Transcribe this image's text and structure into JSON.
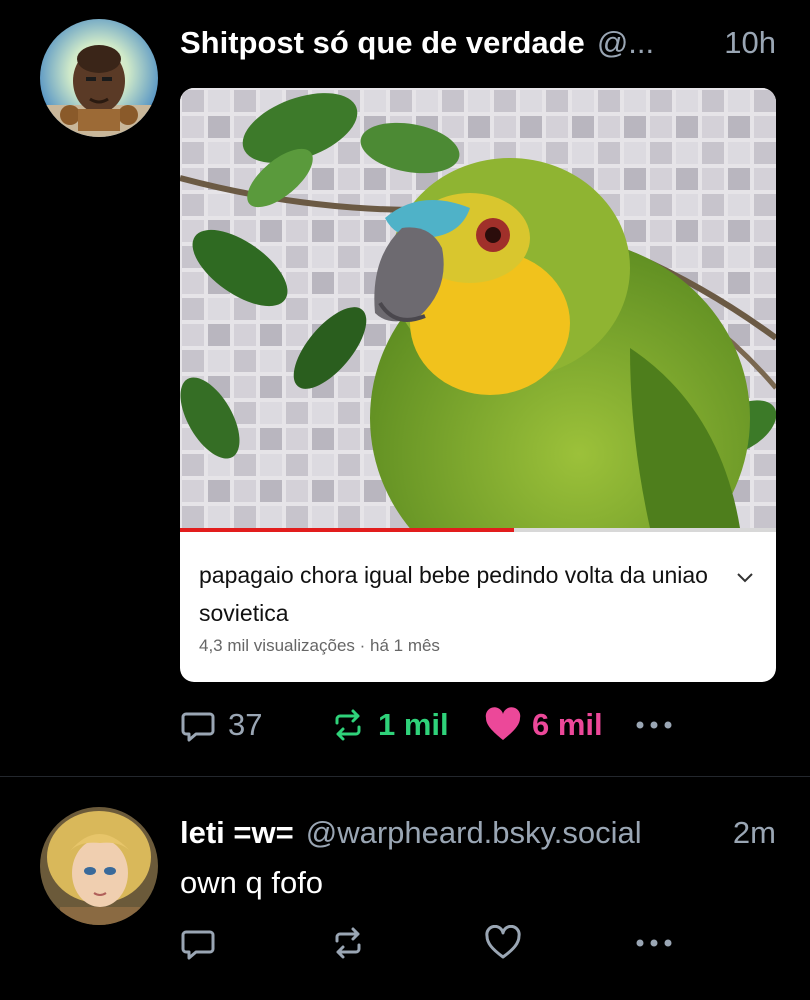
{
  "posts": [
    {
      "author_name": "Shitpost só que de verdade",
      "handle": "@...",
      "time": "10h",
      "video": {
        "title": "papagaio chora igual bebe pedindo volta da uniao sovietica",
        "meta": "4,3 mil visualizações · há 1 mês",
        "progress_percent": 56
      },
      "stats": {
        "replies": "37",
        "reposts": "1 mil",
        "likes": "6 mil"
      }
    },
    {
      "author_name": "leti =w=",
      "handle": "@warpheard.bsky.social",
      "time": "2m",
      "text": "own q fofo"
    }
  ],
  "colors": {
    "background": "#000000",
    "muted": "#9aa6b4",
    "repost_active": "#2fd27a",
    "like_active": "#ec4899",
    "video_progress": "#e21d1d"
  }
}
